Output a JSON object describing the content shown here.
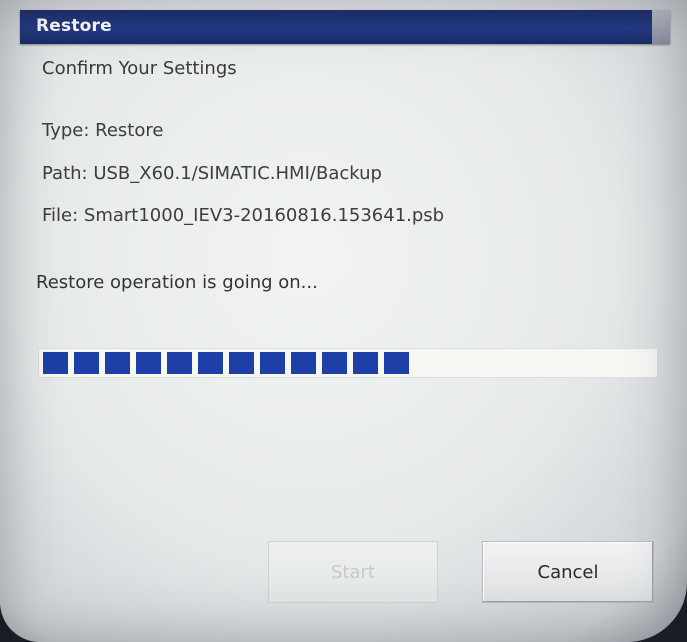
{
  "window": {
    "title": "Restore"
  },
  "dialog": {
    "heading": "Confirm Your Settings",
    "type_line": "Type: Restore",
    "path_line": "Path: USB_X60.1/SIMATIC.HMI/Backup",
    "file_line": "File: Smart1000_IEV3-20160816.153641.psb",
    "status": "Restore operation is going on..."
  },
  "progress": {
    "filled_blocks": 12,
    "fraction": 0.6,
    "bar_color": "#1e3fa6"
  },
  "buttons": {
    "start_label": "Start",
    "cancel_label": "Cancel",
    "start_enabled": false
  },
  "colors": {
    "titlebar": "#233a86",
    "background": "#eceeef"
  }
}
